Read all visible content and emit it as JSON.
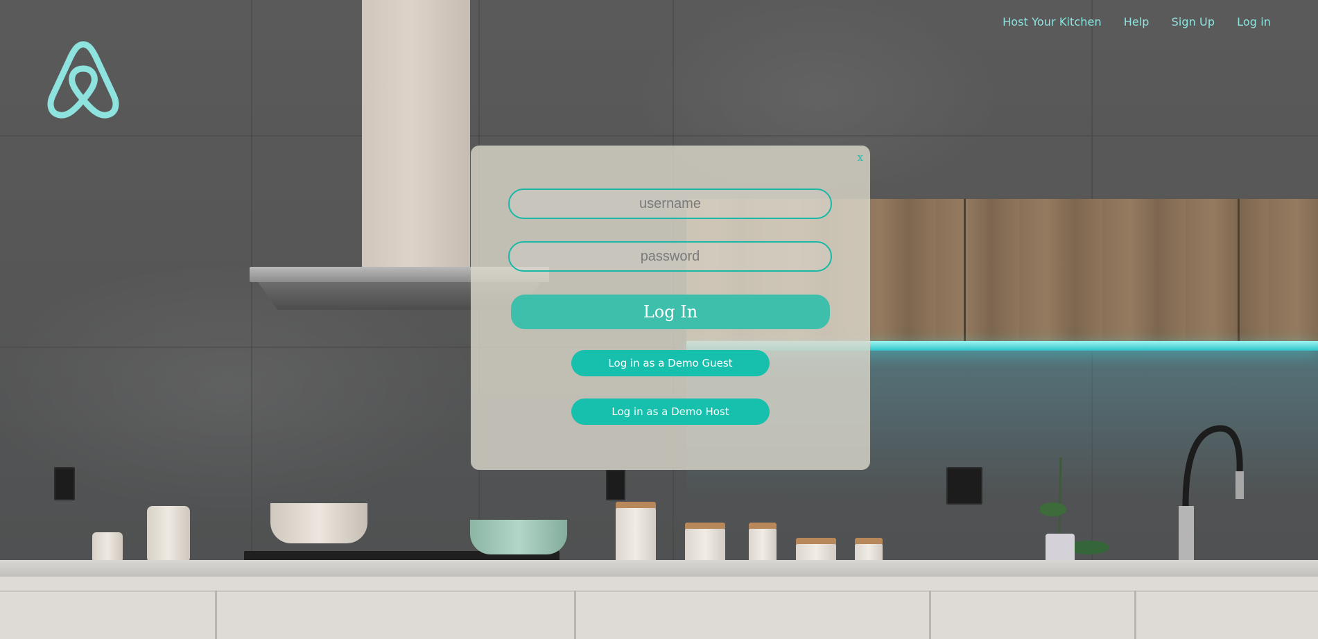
{
  "header": {
    "logo_icon": "airbnb-belo-icon",
    "accent_color": "#8ee3df",
    "nav": [
      {
        "label": "Host Your Kitchen"
      },
      {
        "label": "Help"
      },
      {
        "label": "Sign Up"
      },
      {
        "label": "Log in"
      }
    ]
  },
  "modal": {
    "close_label": "x",
    "username_placeholder": "username",
    "password_placeholder": "password",
    "login_label": "Log In",
    "demo_guest_label": "Log in as a Demo Guest",
    "demo_host_label": "Log in as a Demo Host",
    "accent_color": "#17bfad"
  },
  "background": {
    "scene": "kitchen-photo"
  }
}
